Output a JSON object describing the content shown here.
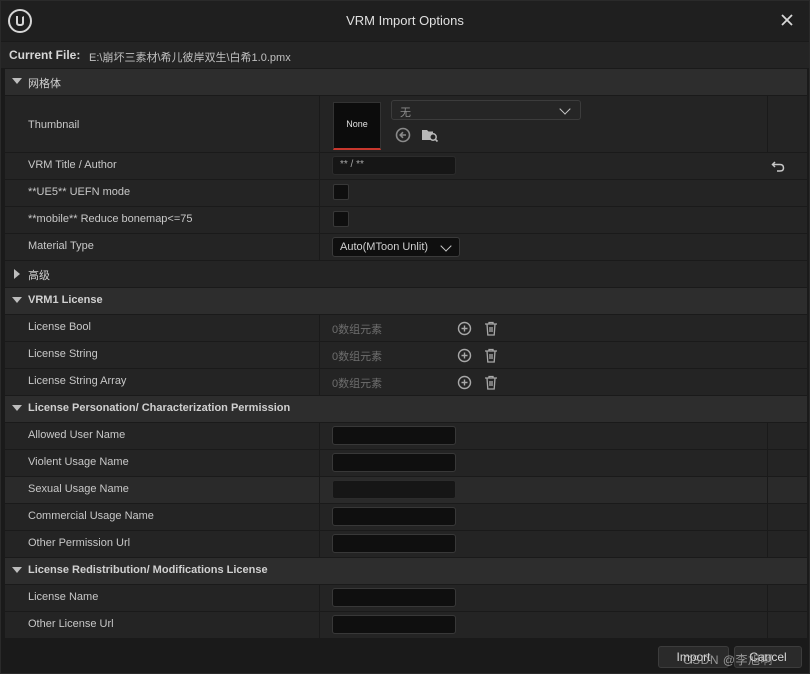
{
  "window": {
    "title": "VRM Import Options"
  },
  "current_file": {
    "label": "Current File:",
    "value": "E:\\崩坏三素材\\希儿彼岸双生\\白希1.0.pmx"
  },
  "sections": {
    "mesh": {
      "label": "网格体"
    },
    "advanced": {
      "label": "高级"
    },
    "vrm1_license": {
      "label": "VRM1 License"
    },
    "personation": {
      "label": "License Personation/ Characterization Permission"
    },
    "redistribution": {
      "label": "License Redistribution/ Modifications License"
    }
  },
  "mesh_rows": {
    "thumbnail": {
      "label": "Thumbnail",
      "preview": "None",
      "asset": "无"
    },
    "title_author": {
      "label": "VRM Title / Author",
      "value": "** / **"
    },
    "uefn": {
      "label": "**UE5** UEFN mode"
    },
    "mobile": {
      "label": "**mobile** Reduce bonemap<=75"
    },
    "material": {
      "label": "Material Type",
      "value": "Auto(MToon Unlit)"
    }
  },
  "vrm1_rows": [
    {
      "label": "License Bool",
      "value": "0数组元素"
    },
    {
      "label": "License String",
      "value": "0数组元素"
    },
    {
      "label": "License String Array",
      "value": "0数组元素"
    }
  ],
  "personation_rows": [
    {
      "label": "Allowed User Name",
      "value": ""
    },
    {
      "label": "Violent Usage Name",
      "value": ""
    },
    {
      "label": "Sexual Usage Name",
      "value": ""
    },
    {
      "label": "Commercial Usage Name",
      "value": ""
    },
    {
      "label": "Other Permission Url",
      "value": ""
    }
  ],
  "redistribution_rows": [
    {
      "label": "License Name",
      "value": ""
    },
    {
      "label": "Other License Url",
      "value": ""
    }
  ],
  "footer": {
    "import_label": "Import",
    "cancel_label": "Cancel",
    "watermark": "CSDN @李旭啊"
  },
  "colors": {
    "accent_red": "#c8372d",
    "panel": "#242424",
    "category": "#2d2d2d"
  }
}
